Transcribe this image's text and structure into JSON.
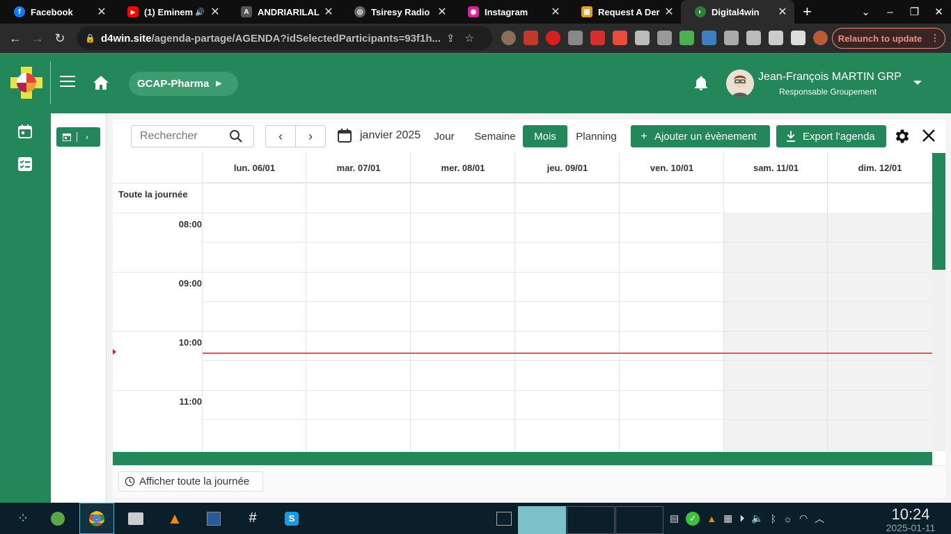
{
  "browser": {
    "tabs": [
      {
        "label": "Facebook",
        "icon": "facebook-icon",
        "color": "#1877f2",
        "glyph": "f"
      },
      {
        "label": "(1) Eminem",
        "icon": "youtube-icon",
        "color": "#ff0000",
        "glyph": "▶"
      },
      {
        "label": "ANDRIARILAL",
        "icon": "profile-icon",
        "color": "#555555",
        "glyph": "A"
      },
      {
        "label": "Tsiresy Radio",
        "icon": "globe-icon",
        "color": "#666666",
        "glyph": "◎"
      },
      {
        "label": "Instagram",
        "icon": "instagram-icon",
        "color": "#d6249f",
        "glyph": "◉"
      },
      {
        "label": "Request A Der",
        "icon": "document-icon",
        "color": "#e0a020",
        "glyph": "▣"
      },
      {
        "label": "Digital4win",
        "icon": "digital4win-icon",
        "color": "#2f7d3a",
        "glyph": "◐"
      }
    ],
    "url_host": "d4win.site",
    "url_path": "/agenda-partage/AGENDA?idSelectedParticipants=93f1h...",
    "relaunch_label": "Relaunch to update"
  },
  "header": {
    "group_label": "GCAP-Pharma",
    "user_name": "Jean-François MARTIN GRP",
    "user_role": "Responsable Groupement"
  },
  "toolbar": {
    "search_placeholder": "Rechercher",
    "month_label": "janvier 2025",
    "views": [
      "Jour",
      "Semaine",
      "Mois",
      "Planning"
    ],
    "active_view": "Mois",
    "add_event_label": "Ajouter un évènement",
    "export_label": "Export l'agenda"
  },
  "calendar": {
    "days": [
      "lun. 06/01",
      "mar. 07/01",
      "mer. 08/01",
      "jeu. 09/01",
      "ven. 10/01",
      "sam. 11/01",
      "dim. 12/01"
    ],
    "all_day_label": "Toute la journée",
    "hours": [
      "08:00",
      "09:00",
      "10:00",
      "11:00"
    ]
  },
  "footer": {
    "show_all_label": "Afficher toute la journée"
  },
  "taskbar": {
    "time": "10:24",
    "date": "2025-01-11"
  },
  "colors": {
    "brand_green": "#23875a",
    "now_line": "#e8564a"
  }
}
